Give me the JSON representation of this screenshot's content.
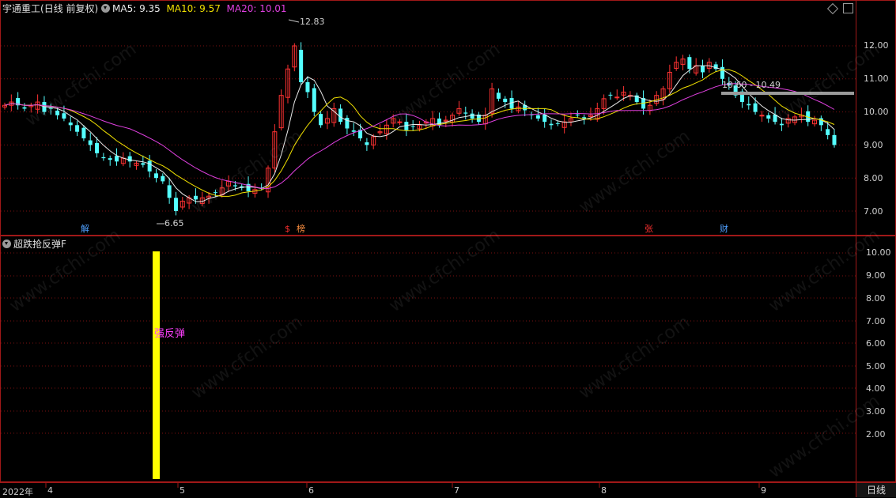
{
  "header": {
    "stock_name": "宇通重工",
    "period": "(日线 前复权)",
    "ma5_label": "MA5: 9.35",
    "ma10_label": "MA10: 9.57",
    "ma20_label": "MA20: 10.01",
    "ma5_color": "#e8e8e8",
    "ma10_color": "#f0e000",
    "ma20_color": "#e040e0"
  },
  "indicator": {
    "name": "超跌抢反弹F",
    "signal_label": "强反弹",
    "signal_color": "#ff40ff",
    "bar_color": "#ffff00"
  },
  "price_axis": [
    "12.00",
    "11.00",
    "10.00",
    "9.00",
    "8.00",
    "7.00"
  ],
  "indicator_axis": [
    "10.00",
    "9.00",
    "8.00",
    "7.00",
    "6.00",
    "5.00",
    "4.00",
    "3.00",
    "2.00"
  ],
  "time_axis": [
    "2022年",
    "4",
    "5",
    "6",
    "7",
    "8",
    "9"
  ],
  "annotations": {
    "high": "12.83",
    "low": "6.65",
    "range": "10.60 - 10.49"
  },
  "events": {
    "e1": "解",
    "e2": "$",
    "e3": "榜",
    "e4": "张",
    "e5": "财"
  },
  "period_button": "日线",
  "watermark": "www.cfchi.com",
  "chart_data": {
    "type": "candlestick",
    "title": "宇通重工 (日线 前复权)",
    "y_range": [
      6.5,
      12.9
    ],
    "notable": {
      "max_high": 12.83,
      "min_low": 6.65
    },
    "ma_last": {
      "MA5": 9.35,
      "MA10": 9.57,
      "MA20": 10.01
    },
    "indicator_series": {
      "name": "超跌抢反弹F",
      "value": 10.0,
      "label": "强反弹"
    },
    "colors": {
      "up": "#ff3232",
      "down": "#54ffff"
    }
  }
}
